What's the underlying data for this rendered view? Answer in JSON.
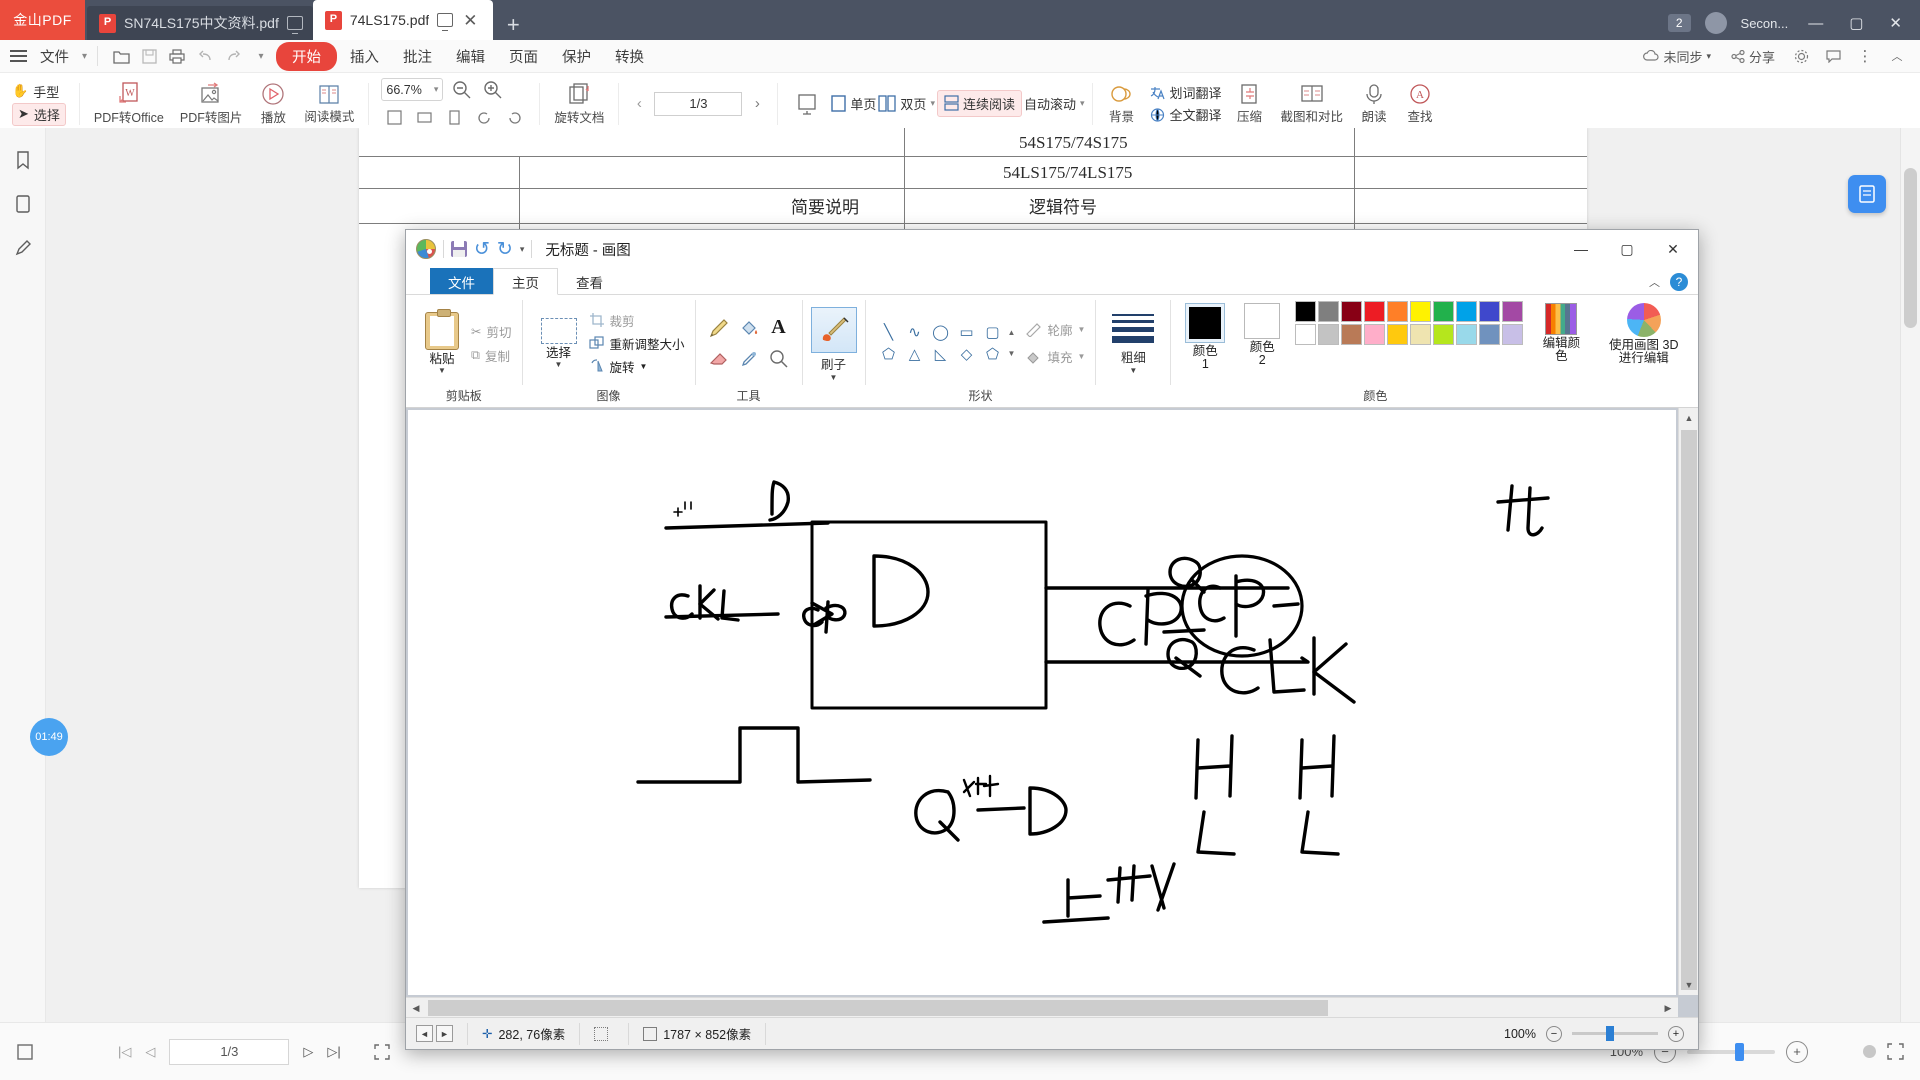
{
  "pdf_app": {
    "brand": "金山PDF",
    "tabs": [
      {
        "title": "SN74LS175中文资料.pdf",
        "active": false
      },
      {
        "title": "74LS175.pdf",
        "active": true
      }
    ],
    "new_tab_label": "+",
    "tab_right": {
      "count_badge": "2",
      "account": "Secon...",
      "minimize": "—",
      "maximize": "▢",
      "close": "✕"
    },
    "menu": {
      "file_label": "文件",
      "items": [
        "开始",
        "插入",
        "批注",
        "编辑",
        "页面",
        "保护",
        "转换"
      ],
      "active_item": "开始",
      "right_items": [
        {
          "label": "未同步",
          "icon": "cloud-sync-icon"
        },
        {
          "label": "分享",
          "icon": "share-icon"
        },
        {
          "label": "",
          "icon": "gear-icon"
        },
        {
          "label": "",
          "icon": "comment-icon"
        },
        {
          "label": "",
          "icon": "more-icon"
        },
        {
          "label": "",
          "icon": "chevron-up-icon"
        }
      ]
    },
    "ribbon": {
      "hand_tool": "手型",
      "select_tool": "选择",
      "pdf_to_office": "PDF转Office",
      "pdf_to_image": "PDF转图片",
      "play": "播放",
      "read_mode": "阅读模式",
      "zoom_value": "66.7%",
      "rotate_doc": "旋转文档",
      "single_page": "单页",
      "double_page": "双页",
      "continuous_scroll": "连续阅读",
      "auto_scroll": "自动滚动",
      "background": "背景",
      "word_translate": "划词翻译",
      "full_translate": "全文翻译",
      "compress": "压缩",
      "screenshot_compare": "截图和对比",
      "read_aloud": "朗读",
      "find": "查找",
      "page_indicator": "1/3"
    },
    "document": {
      "rows": [
        "54S175/74S175",
        "54LS175/74LS175"
      ],
      "col_left": "简要说明",
      "col_right": "逻辑符号"
    },
    "bottom": {
      "page_indicator": "1/3",
      "zoom_percent": "100%",
      "first": "|◁",
      "prev": "◁",
      "next": "▷",
      "last": "▷|"
    },
    "timer_badge": "01:49"
  },
  "paint": {
    "title": "无标题 - 画图",
    "quick_access": [
      "save-icon",
      "undo-icon",
      "redo-icon",
      "customize-icon"
    ],
    "window_controls": {
      "minimize": "—",
      "maximize": "▢",
      "close": "✕"
    },
    "tabs": [
      {
        "label": "文件",
        "type": "file"
      },
      {
        "label": "主页",
        "type": "selected"
      },
      {
        "label": "查看",
        "type": "normal"
      }
    ],
    "groups": [
      {
        "name": "剪贴板",
        "paste": "粘贴",
        "cut": "剪切",
        "copy": "复制"
      },
      {
        "name": "图像",
        "select": "选择",
        "crop": "裁剪",
        "resize": "重新调整大小",
        "rotate": "旋转"
      },
      {
        "name": "工具",
        "tools": [
          "pencil-icon",
          "fill-bucket-icon",
          "text-icon"
        ]
      },
      {
        "name": "",
        "brush": "刷子"
      },
      {
        "name": "形状",
        "outline": "轮廓",
        "fill": "填充"
      },
      {
        "name": "",
        "size": "粗细"
      },
      {
        "name": "颜色",
        "color1": "颜色 1",
        "color2": "颜色 2",
        "edit_colors": "编辑颜色",
        "paint3d": "使用画图 3D 进行编辑"
      }
    ],
    "color1_value": "#000000",
    "color2_value": "#ffffff",
    "palette_row1": [
      "#000000",
      "#7f7f7f",
      "#880015",
      "#ed1c24",
      "#ff7f27",
      "#fff200",
      "#22b14c",
      "#00a2e8",
      "#3f48cc",
      "#a349a4"
    ],
    "palette_row2": [
      "#ffffff",
      "#c3c3c3",
      "#b97a57",
      "#ffaec9",
      "#ffc90e",
      "#efe4b0",
      "#b5e61d",
      "#99d9ea",
      "#7092be",
      "#c8bfe7"
    ],
    "status": {
      "cursor_position": "282, 76像素",
      "selection_size": "",
      "image_size": "1787 × 852像素",
      "zoom_percent": "100%"
    },
    "canvas_drawing": {
      "labels": [
        "D",
        "CLK",
        "Q",
        "CP",
        "CLK",
        "H",
        "H"
      ],
      "description": "hand-drawn D flip-flop schematic with clock waveform"
    }
  }
}
